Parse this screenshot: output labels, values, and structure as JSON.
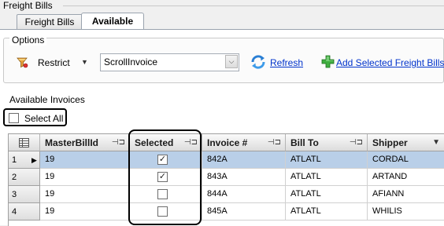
{
  "group": {
    "title": "Freight Bills"
  },
  "tabs": [
    {
      "label": "Freight Bills",
      "active": false
    },
    {
      "label": "Available",
      "active": true
    }
  ],
  "options": {
    "label": "Options",
    "restrict_label": "Restrict",
    "scroll_value": "ScrollInvoice",
    "refresh_label": "Refresh",
    "add_selected_label": "Add Selected Freight Bills"
  },
  "available": {
    "label": "Available Invoices",
    "select_all_label": "Select All"
  },
  "grid": {
    "columns": [
      "MasterBillId",
      "Selected",
      "Invoice #",
      "Bill To",
      "Shipper"
    ],
    "rows": [
      {
        "num": "1",
        "master": "19",
        "selected": true,
        "invoice": "842A",
        "billto": "ATLATL",
        "shipper": "CORDAL",
        "current": true
      },
      {
        "num": "2",
        "master": "19",
        "selected": true,
        "invoice": "843A",
        "billto": "ATLATL",
        "shipper": "ARTAND",
        "current": false
      },
      {
        "num": "3",
        "master": "19",
        "selected": false,
        "invoice": "844A",
        "billto": "ATLATL",
        "shipper": "AFIANN",
        "current": false
      },
      {
        "num": "4",
        "master": "19",
        "selected": false,
        "invoice": "845A",
        "billto": "ATLATL",
        "shipper": "WHILIS",
        "current": false
      }
    ]
  },
  "colors": {
    "link": "#0033cc",
    "selected_row": "#b9cfe8"
  }
}
